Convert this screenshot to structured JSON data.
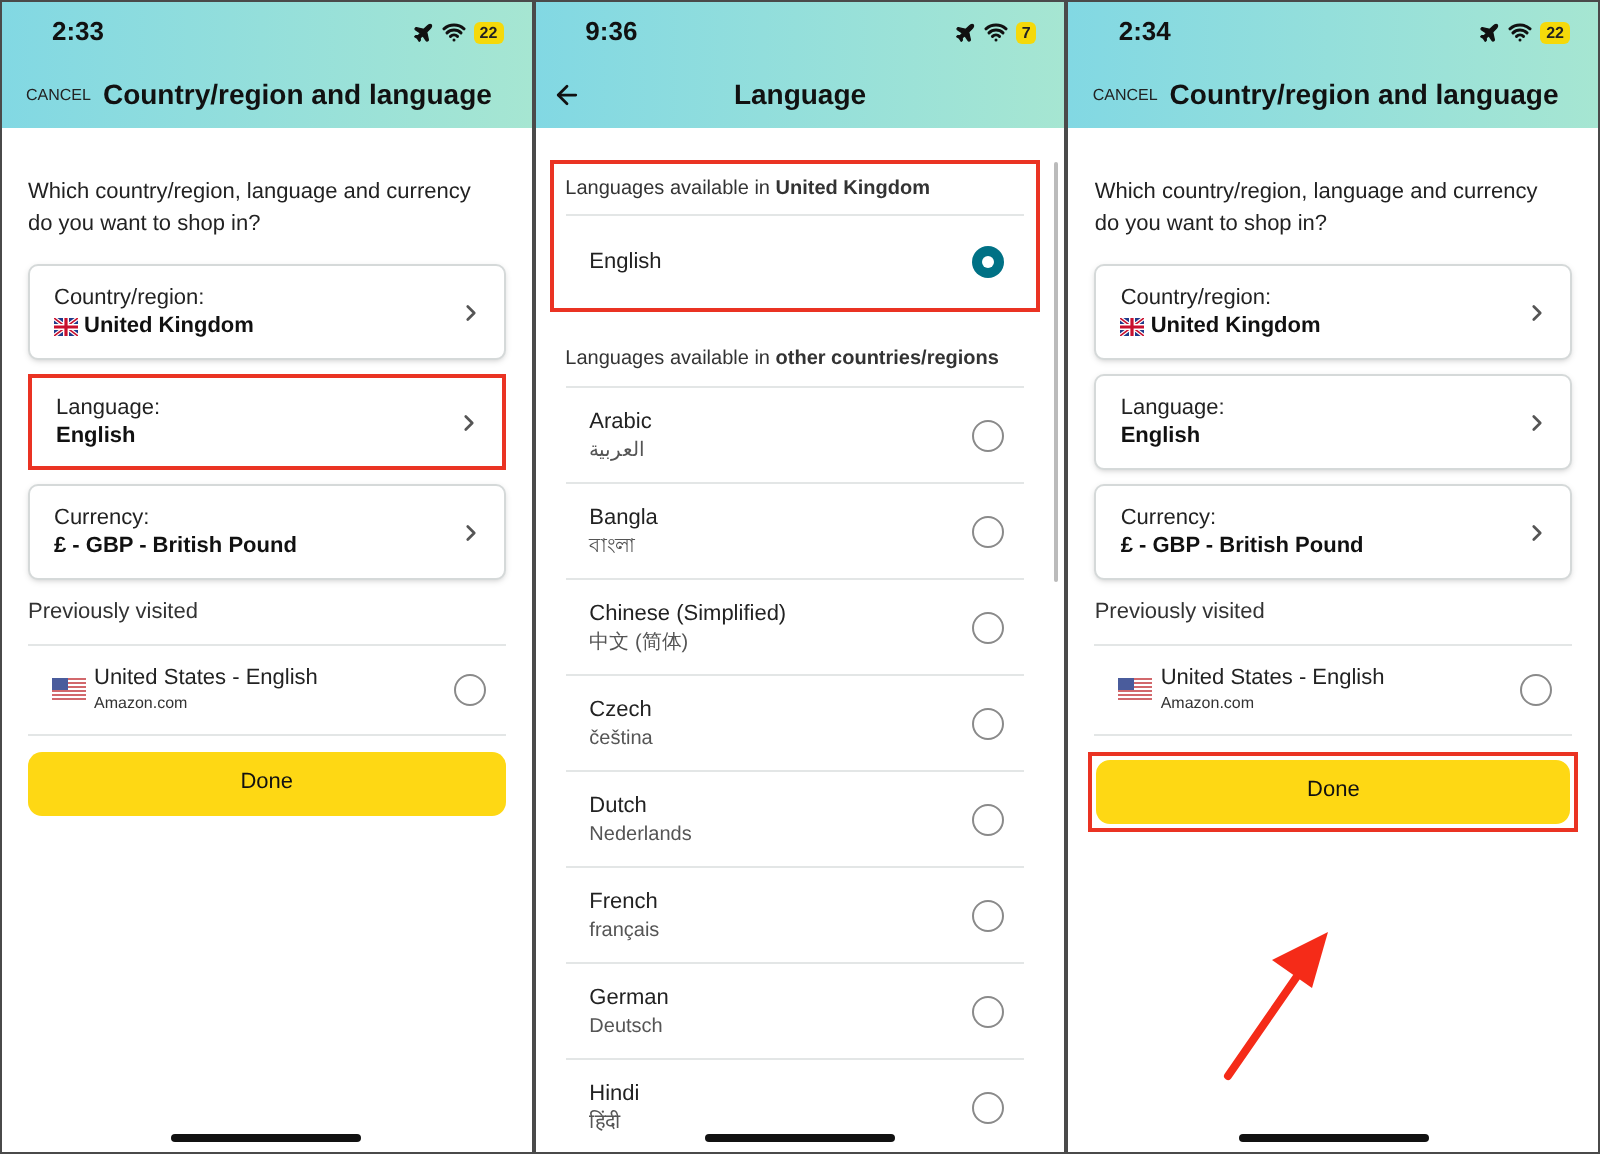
{
  "screens": [
    {
      "kind": "settings",
      "status": {
        "time": "2:33",
        "battery": "22"
      },
      "header": {
        "cancel": "CANCEL",
        "title": "Country/region and language"
      },
      "question": "Which country/region, language and currency do you want to shop in?",
      "options": [
        {
          "label": "Country/region:",
          "value": "United Kingdom",
          "kind": "uk_flag",
          "highlighted": false
        },
        {
          "label": "Language:",
          "value": "English",
          "kind": "plain",
          "highlighted": true
        },
        {
          "label": "Currency:",
          "value": "£ - GBP - British Pound",
          "kind": "plain",
          "highlighted": false
        }
      ],
      "previous_label": "Previously visited",
      "previous": [
        {
          "name": "United States - English",
          "site": "Amazon.com",
          "kind": "us_flag",
          "selected": false
        }
      ],
      "done": {
        "label": "Done",
        "highlighted": false,
        "arrow": false
      }
    },
    {
      "kind": "language",
      "status": {
        "time": "9:36",
        "battery": "7"
      },
      "header": {
        "title": "Language"
      },
      "current": {
        "heading": "Languages available in **United Kingdom**",
        "highlighted": true,
        "items": [
          {
            "name": "English",
            "selected": true
          }
        ]
      },
      "other": {
        "heading": "Languages available in **other countries/regions**",
        "items": [
          {
            "name": "Arabic",
            "native": "العربية",
            "selected": false
          },
          {
            "name": "Bangla",
            "native": "বাংলা",
            "selected": false
          },
          {
            "name": "Chinese (Simplified)",
            "native": "中文 (简体)",
            "selected": false
          },
          {
            "name": "Czech",
            "native": "čeština",
            "selected": false
          },
          {
            "name": "Dutch",
            "native": "Nederlands",
            "selected": false
          },
          {
            "name": "French",
            "native": "français",
            "selected": false
          },
          {
            "name": "German",
            "native": "Deutsch",
            "selected": false
          },
          {
            "name": "Hindi",
            "native": "हिंदी",
            "selected": false
          }
        ]
      }
    },
    {
      "kind": "settings",
      "status": {
        "time": "2:34",
        "battery": "22"
      },
      "header": {
        "cancel": "CANCEL",
        "title": "Country/region and language"
      },
      "question": "Which country/region, language and currency do you want to shop in?",
      "options": [
        {
          "label": "Country/region:",
          "value": "United Kingdom",
          "kind": "uk_flag",
          "highlighted": false
        },
        {
          "label": "Language:",
          "value": "English",
          "kind": "plain",
          "highlighted": false
        },
        {
          "label": "Currency:",
          "value": "£ - GBP - British Pound",
          "kind": "plain",
          "highlighted": false
        }
      ],
      "previous_label": "Previously visited",
      "previous": [
        {
          "name": "United States - English",
          "site": "Amazon.com",
          "kind": "us_flag",
          "selected": false
        }
      ],
      "done": {
        "label": "Done",
        "highlighted": true,
        "arrow": true
      }
    }
  ]
}
